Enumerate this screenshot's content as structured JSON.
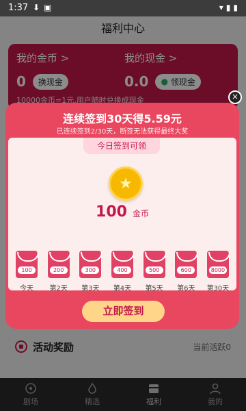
{
  "status_bar": {
    "time": "1:37"
  },
  "header": {
    "title": "福利中心"
  },
  "wallet": {
    "coins": {
      "title": "我的金币 >",
      "value": "0",
      "button": "换现金"
    },
    "cash": {
      "title": "我的现金 >",
      "value": "0.0",
      "button": "领现金"
    },
    "note": "10000金币=1元,用户随时兑换成现金"
  },
  "activity": {
    "title": "活动奖励",
    "status": "当前活跃0"
  },
  "modal": {
    "title": "连续签到30天得5.59元",
    "subtitle": "已连续签到2/30天，断签无法获得最终大奖",
    "today_tag": "今日签到可领",
    "reward_amount": "100",
    "reward_unit": "金币",
    "sign_button": "立即签到",
    "close_symbol": "×",
    "days": [
      {
        "value": "100",
        "label": "今天"
      },
      {
        "value": "200",
        "label": "第2天"
      },
      {
        "value": "300",
        "label": "第3天"
      },
      {
        "value": "400",
        "label": "第4天"
      },
      {
        "value": "500",
        "label": "第5天"
      },
      {
        "value": "600",
        "label": "第6天"
      },
      {
        "value": "8000",
        "label": "第30天"
      }
    ]
  },
  "nav": {
    "items": [
      {
        "label": "剧场",
        "icon": "theater-icon"
      },
      {
        "label": "精选",
        "icon": "flame-icon"
      },
      {
        "label": "福利",
        "icon": "gift-icon"
      },
      {
        "label": "我的",
        "icon": "profile-icon"
      }
    ],
    "active": "福利"
  }
}
